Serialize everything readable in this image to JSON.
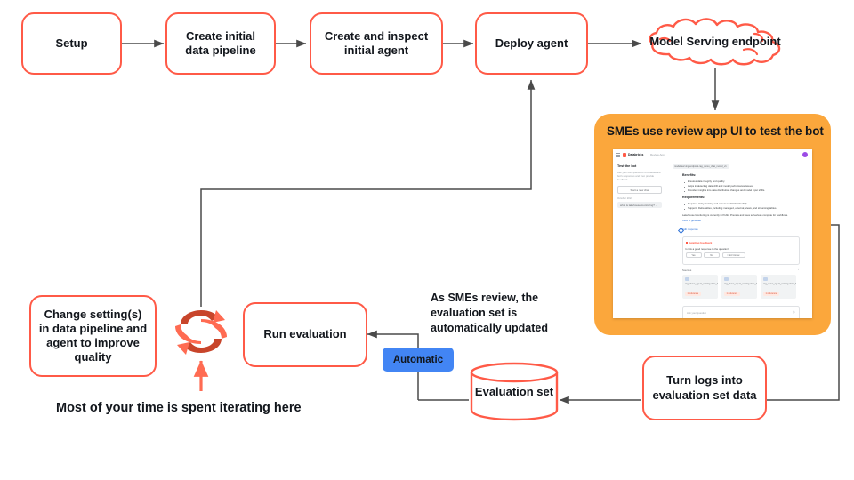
{
  "theme": {
    "box_border": "#FF5A47",
    "panel_bg": "#FBA73C",
    "badge_bg": "#4285F4",
    "wire": "#4a4a4a",
    "loop_front": "#FF6B52",
    "loop_back": "#C8452B",
    "text": "#12161C",
    "page_bg": "#FFFFFF"
  },
  "nodes": {
    "setup": "Setup",
    "create_pipeline": "Create initial\ndata pipeline",
    "create_pipeline_l1": "Create initial",
    "create_pipeline_l2": "data pipeline",
    "inspect_agent_l1": "Create and inspect",
    "inspect_agent_l2": "initial agent",
    "deploy_agent": "Deploy agent",
    "model_serving_l1": "Model Serving",
    "model_serving_l2": "endpoint",
    "change_settings_l1": "Change setting(s)",
    "change_settings_l2": "in data pipeline and",
    "change_settings_l3": "agent to improve",
    "change_settings_l4": "quality",
    "run_evaluation": "Run evaluation",
    "evaluation_set": "Evaluation set",
    "turn_logs_l1": "Turn logs into",
    "turn_logs_l2": "evaluation set data"
  },
  "badges": {
    "automatic": "Automatic"
  },
  "annotations": {
    "sme_review_l1": "As SMEs review, the",
    "sme_review_l2": "evaluation set is",
    "sme_review_l3": "automatically updated",
    "caption": "Most of your time is spent iterating here"
  },
  "panel": {
    "title": "SMEs use review app UI to test the bot"
  },
  "review_app": {
    "brand": "Databricks",
    "app_name": "Review App",
    "sidebar": {
      "title": "Test the bot",
      "subtitle": "Ask your own questions to evaluate the bot's responses and then provide feedback.",
      "new_chat_button": "Start a new chat",
      "section_label": "October 2024",
      "chat_item": "what is lakehouse monitoring? ..."
    },
    "main": {
      "model_pill": "model-serving-endpoint-rag_demo_chat_model_v1",
      "benefits_heading": "Benefits:",
      "benefits": [
        "Ensures data integrity and quality.",
        "Helps in detecting data drift and model performance issues.",
        "Provides insights into data distribution changes and model input shifts."
      ],
      "requirements_heading": "Requirements:",
      "requirements": [
        "Requires Unity Catalog and access to Databricks SQL.",
        "Supports Delta tables, including managed, external, views, and streaming tables."
      ],
      "note": "Lakehouse Monitoring is currently in Public Preview and uses serverless compute for workflows.",
      "link": "Click to generate",
      "edit_action": "Edit response",
      "feedback": {
        "title": "Awaiting feedback",
        "question": "Is this a good response to the question?",
        "yes_button": "Yes",
        "no_button": "No",
        "dont_know_button": "I don't know",
        "thumb_up_icon": "thumbs-up-icon",
        "thumb_down_icon": "thumbs-down-icon"
      },
      "sources_label": "Sources",
      "sources": [
        {
          "title": "rag_demo_agent_catalog.docs_databricks_doc.lakehouse_...",
          "badge": "1 reference"
        },
        {
          "title": "rag_demo_agent_catalog.docs_databricks_doc.lakehouse_...",
          "badge": "1 reference"
        },
        {
          "title": "rag_demo_agent_catalog.docs_databricks_doc.lakehouse_...",
          "badge": "1 reference"
        }
      ],
      "input_placeholder": "Ask your question",
      "send_icon": "send-icon"
    }
  }
}
